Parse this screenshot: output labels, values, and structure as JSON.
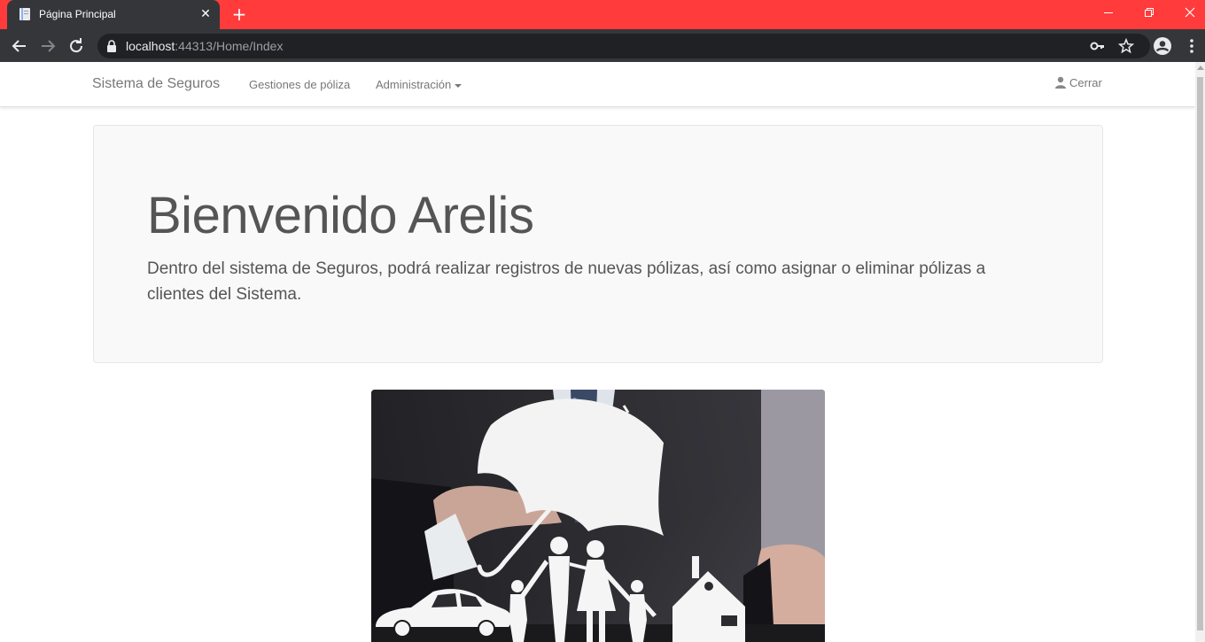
{
  "browser": {
    "tab_title": "Página Principal",
    "url_host": "localhost",
    "url_rest": ":44313/Home/Index",
    "accent_color": "#ff3b3b"
  },
  "navbar": {
    "brand": "Sistema de Seguros",
    "links": [
      "Gestiones de póliza",
      "Administración"
    ],
    "logout": "Cerrar"
  },
  "jumbotron": {
    "heading": "Bienvenido Arelis",
    "text": "Dentro del sistema de Seguros, podrá realizar registros de nuevas pólizas, así como asignar o eliminar pólizas a clientes del Sistema."
  },
  "icons": {
    "page_icon": "file-icon",
    "user_icon": "user-icon",
    "key_icon": "key-icon",
    "star_icon": "star-icon",
    "profile_icon": "account-circle-icon",
    "menu_icon": "kebab-menu-icon"
  }
}
